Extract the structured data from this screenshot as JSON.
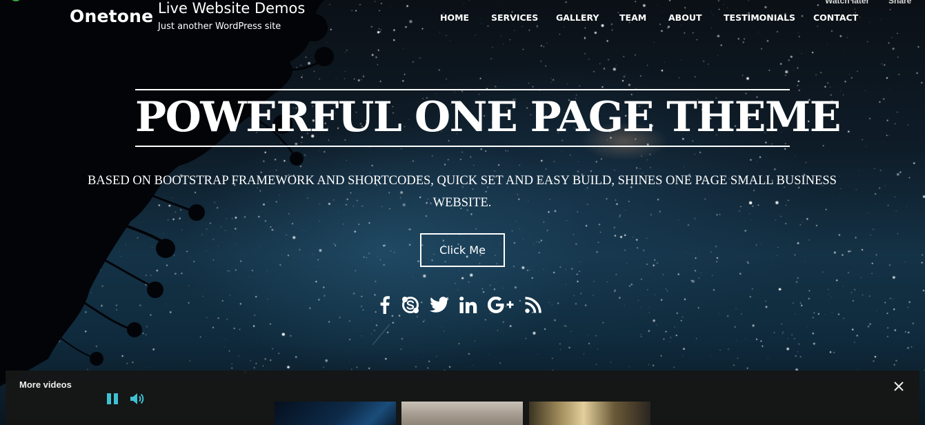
{
  "youtube_overlay": {
    "watch_later_label": "Watch later",
    "share_label": "Share"
  },
  "header": {
    "logo_text": "Onetone",
    "site_title": "Live Website Demos",
    "tagline": "Just another WordPress site"
  },
  "nav": {
    "items": [
      {
        "label": "HOME"
      },
      {
        "label": "SERVICES"
      },
      {
        "label": "GALLERY"
      },
      {
        "label": "TEAM"
      },
      {
        "label": "ABOUT"
      },
      {
        "label": "TESTIMONIALS"
      },
      {
        "label": "CONTACT"
      }
    ]
  },
  "hero": {
    "title": "POWERFUL ONE PAGE THEME",
    "subtitle": "BASED ON BOOTSTRAP FRAMEWORK AND SHORTCODES, QUICK SET AND EASY BUILD, SHINES ONE PAGE SMALL BUSINESS WEBSITE.",
    "cta_label": "Click Me",
    "social_icons": [
      "facebook-icon",
      "skype-icon",
      "twitter-icon",
      "linkedin-icon",
      "google-plus-icon",
      "rss-icon"
    ]
  },
  "more_videos": {
    "title": "More videos",
    "controls": [
      "pause-icon",
      "volume-icon",
      "close-icon"
    ]
  },
  "colors": {
    "text": "#ffffff",
    "panel_bg": "#161616",
    "player_accent": "#3ec1d3",
    "sky": "#143246"
  }
}
